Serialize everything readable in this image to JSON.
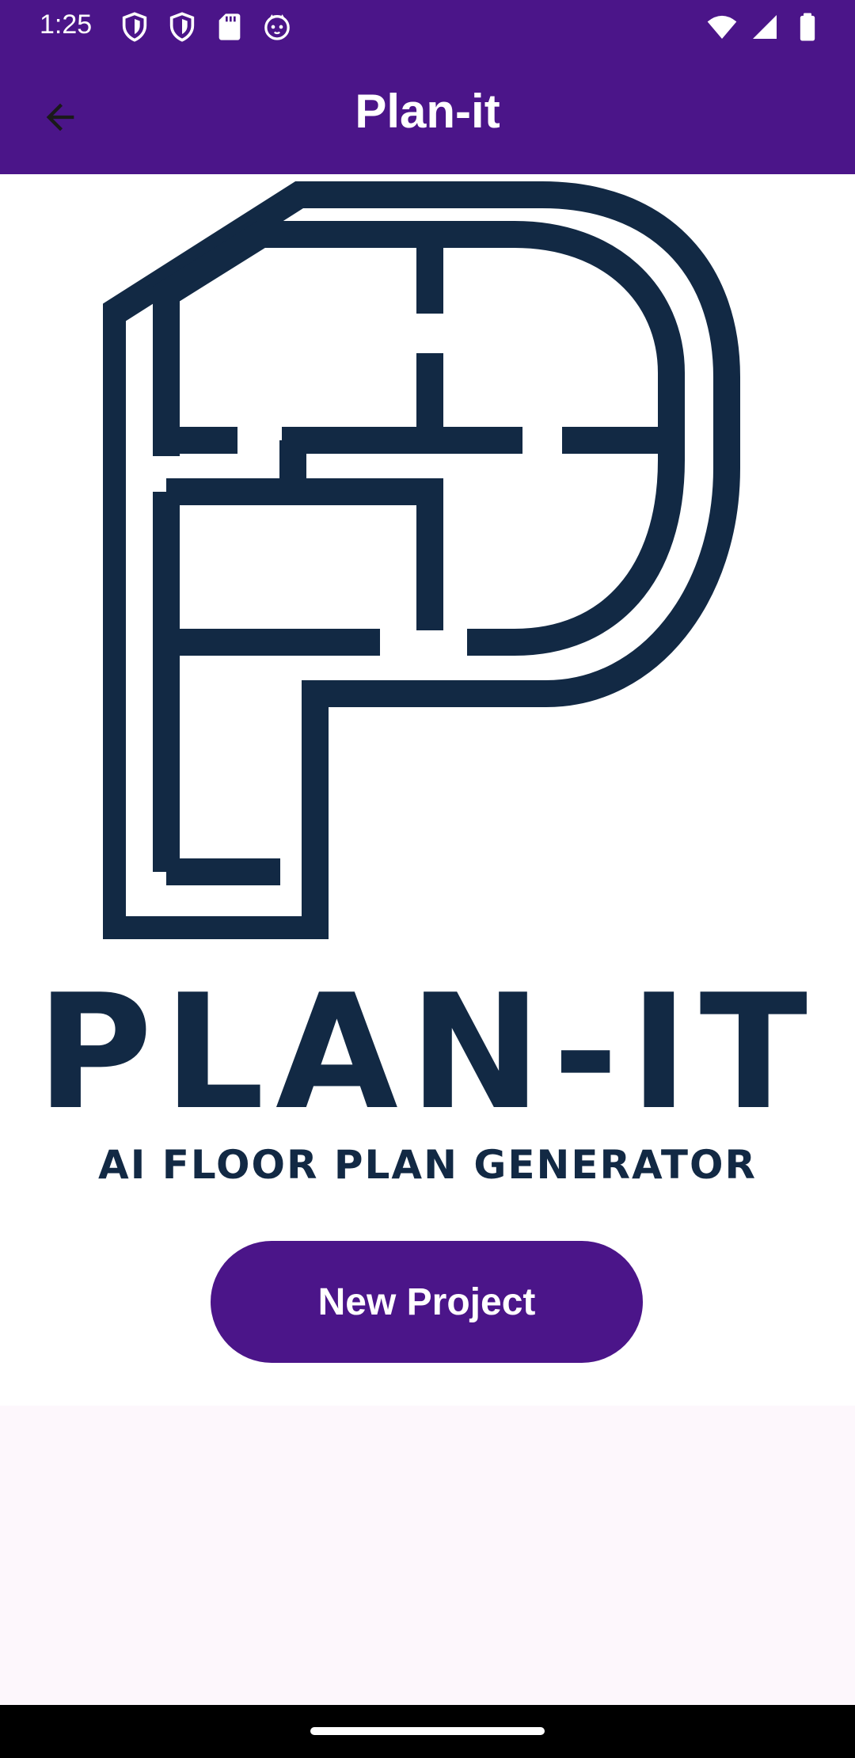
{
  "status_bar": {
    "time": "1:25",
    "left_icons": [
      "shield-icon",
      "shield-icon",
      "sd-card-icon",
      "cat-face-icon"
    ],
    "right_icons": [
      "wifi-icon",
      "signal-icon",
      "battery-icon"
    ]
  },
  "app_bar": {
    "title": "Plan-it",
    "back_icon": "arrow-back-icon",
    "background_color": "#4b1589"
  },
  "logo": {
    "wordmark": "PLAN-IT",
    "tagline": "AI FLOOR PLAN GENERATOR",
    "color": "#122944"
  },
  "actions": {
    "new_project_label": "New Project"
  },
  "colors": {
    "primary": "#4b1589",
    "page_background": "#fdf7fc",
    "logo_navy": "#122944"
  }
}
